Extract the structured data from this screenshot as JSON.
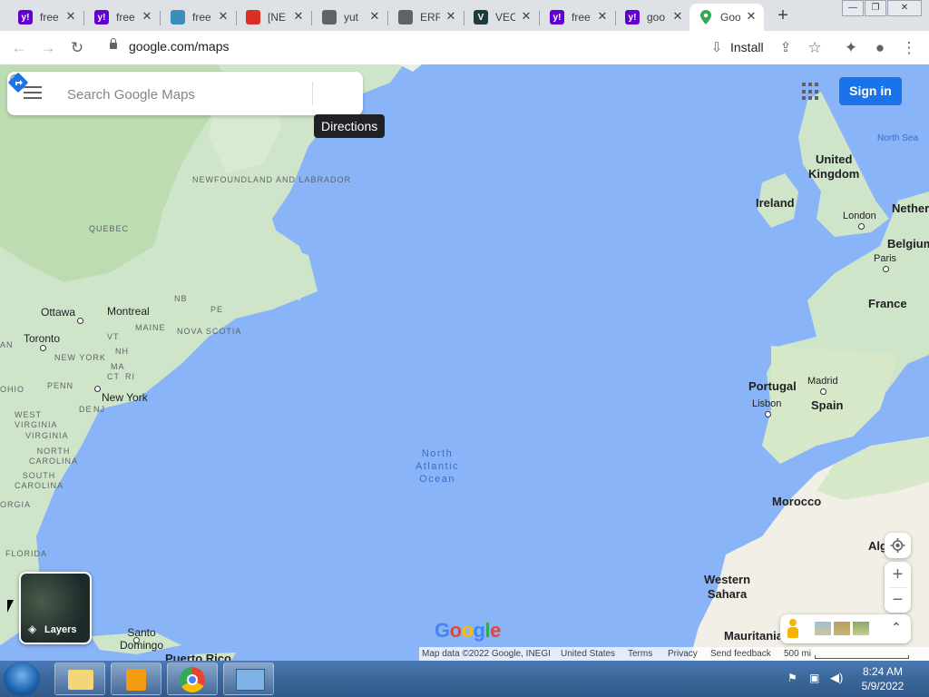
{
  "browser": {
    "tabs": [
      {
        "label": "free",
        "favicon": "yahoo-favicon",
        "color": "#6001d2"
      },
      {
        "label": "free",
        "favicon": "yahoo-favicon",
        "color": "#6001d2"
      },
      {
        "label": "free",
        "favicon": "doc-search-favicon",
        "color": "#3a8fb7"
      },
      {
        "label": "[NE",
        "favicon": "eye-favicon",
        "color": "#d93025"
      },
      {
        "label": "yut",
        "favicon": "globe-favicon",
        "color": "#5f6368"
      },
      {
        "label": "ERR",
        "favicon": "globe-favicon",
        "color": "#5f6368"
      },
      {
        "label": "VEC",
        "favicon": "vecteezy-favicon",
        "color": "#1e3a3a"
      },
      {
        "label": "free",
        "favicon": "yahoo-favicon",
        "color": "#6001d2"
      },
      {
        "label": "goo",
        "favicon": "yahoo-favicon",
        "color": "#6001d2"
      },
      {
        "label": "Goo",
        "favicon": "google-maps-favicon",
        "color": "#34a853",
        "active": true
      }
    ],
    "url": "google.com/maps",
    "install_label": "Install"
  },
  "search": {
    "placeholder": "Search Google Maps",
    "tooltip": "Directions"
  },
  "header": {
    "signin_label": "Sign in"
  },
  "map": {
    "countries": [
      "United Kingdom",
      "Ireland",
      "France",
      "Portugal",
      "Spain",
      "Morocco",
      "Western Sahara",
      "Mauritania",
      "Alg",
      "Belgium",
      "Nether"
    ],
    "cities": [
      "Ottawa",
      "Montreal",
      "Toronto",
      "New York",
      "London",
      "Paris",
      "Madrid",
      "Lisbon",
      "Santo Domingo",
      "Puerto Rico"
    ],
    "regions": [
      "NEWFOUNDLAND AND LABRADOR",
      "QUEBEC",
      "NB",
      "PE",
      "MAINE",
      "NOVA SCOTIA",
      "VT",
      "NH",
      "NEW YORK",
      "MA",
      "CT",
      "RI",
      "PENN",
      "NJ",
      "DE",
      "OHIO",
      "WEST VIRGINIA",
      "VIRGINIA",
      "NORTH CAROLINA",
      "SOUTH CAROLINA",
      "ORGIA",
      "FLORIDA",
      "AN"
    ],
    "ocean": "North Atlantic Ocean",
    "sea": "North Sea",
    "layers_label": "Layers",
    "google_logo": "Google"
  },
  "attribution": {
    "map_data": "Map data ©2022 Google, INEGI",
    "region": "United States",
    "terms": "Terms",
    "privacy": "Privacy",
    "feedback": "Send feedback",
    "scale": "500 mi"
  },
  "taskbar": {
    "time": "8:24 AM",
    "date": "5/9/2022"
  },
  "colors": {
    "water": "#8ab4f8",
    "land": "#cfe5c9",
    "accent": "#1a73e8"
  }
}
